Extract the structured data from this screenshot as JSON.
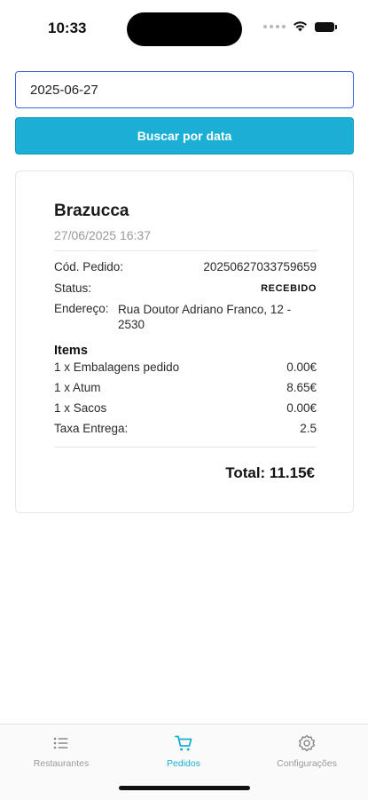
{
  "status_bar": {
    "time": "10:33"
  },
  "search": {
    "date_value": "2025-06-27",
    "button_label": "Buscar por data"
  },
  "order": {
    "restaurant": "Brazucca",
    "datetime": "27/06/2025 16:37",
    "code_label": "Cód. Pedido:",
    "code_value": "20250627033759659",
    "status_label": "Status:",
    "status_value": "RECEBIDO",
    "address_label": "Endereço:",
    "address_value": "Rua Doutor Adriano Franco, 12 - 2530",
    "items_heading": "Items",
    "items": [
      {
        "label": "1 x Embalagens pedido",
        "price": "0.00€"
      },
      {
        "label": "1 x Atum",
        "price": "8.65€"
      },
      {
        "label": "1 x Sacos",
        "price": "0.00€"
      },
      {
        "label": "Taxa Entrega:",
        "price": "2.5"
      }
    ],
    "total": "Total: 11.15€"
  },
  "tabs": [
    {
      "label": "Restaurantes",
      "icon": "list-icon",
      "active": false
    },
    {
      "label": "Pedidos",
      "icon": "cart-icon",
      "active": true
    },
    {
      "label": "Configurações",
      "icon": "gear-icon",
      "active": false
    }
  ],
  "colors": {
    "accent": "#1cafd6",
    "input_border": "#3f63e0",
    "inactive_tab": "#9a9a9a"
  }
}
